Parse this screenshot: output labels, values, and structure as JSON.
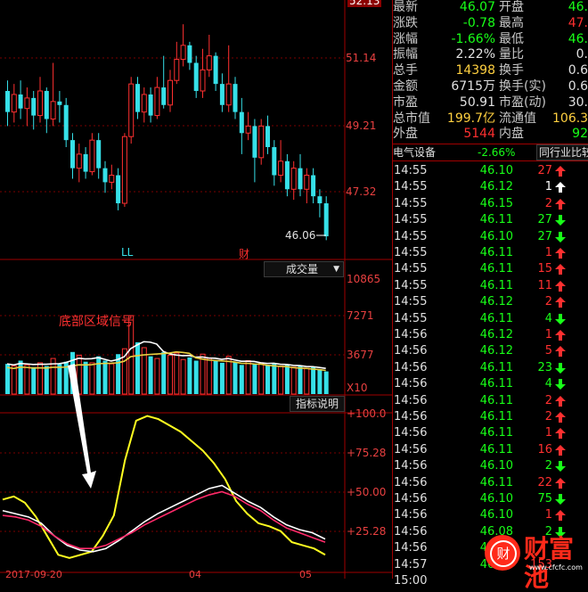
{
  "chart_panel": {
    "price_labels": [
      "52.13",
      "51.14",
      "49.21",
      "47.32"
    ],
    "current_price_marker": "46.06",
    "marker_ll": "LL",
    "marker_cai": "财",
    "volume_selector": "成交量",
    "volume_labels": [
      "10865",
      "7271",
      "3677",
      "X10"
    ],
    "annotation": "底部区域信号",
    "indicator_button": "指标说明",
    "indicator_labels": [
      "+100.0",
      "+75.28",
      "+50.00",
      "+25.28"
    ],
    "date_labels": [
      "2017-09-20",
      "04",
      "05"
    ],
    "colors": {
      "up": "#ff3030",
      "down": "#36e0e8",
      "grid": "#7a0000"
    }
  },
  "quote_panel": {
    "rows": [
      {
        "label": "最新",
        "value": "46.07",
        "label2": "开盘",
        "value2": "46.",
        "color": "#18ff18",
        "color2": "#18ff18"
      },
      {
        "label": "涨跌",
        "value": "-0.78",
        "label2": "最高",
        "value2": "47.",
        "color": "#18ff18",
        "color2": "#ff3030"
      },
      {
        "label": "涨幅",
        "value": "-1.66%",
        "label2": "最低",
        "value2": "46.",
        "color": "#18ff18",
        "color2": "#18ff18"
      },
      {
        "label": "振幅",
        "value": "2.22%",
        "label2": "量比",
        "value2": "0.",
        "color": "#e0e0e0",
        "color2": "#e0e0e0"
      },
      {
        "label": "总手",
        "value": "14398",
        "label2": "换手",
        "value2": "0.6",
        "color": "#ffd040",
        "color2": "#e0e0e0"
      },
      {
        "label": "金额",
        "value": "6715万",
        "label2": "换手(实)",
        "value2": "0.6",
        "color": "#e0e0e0",
        "color2": "#e0e0e0"
      },
      {
        "label": "市盈",
        "value": "50.91",
        "label2": "市盈(动)",
        "value2": "30.",
        "color": "#e0e0e0",
        "color2": "#e0e0e0"
      },
      {
        "label": "总市值",
        "value": "199.7亿",
        "label2": "流通值",
        "value2": "106.3",
        "color": "#ffd040",
        "color2": "#ffd040"
      },
      {
        "label": "外盘",
        "value": "5144",
        "label2": "内盘",
        "value2": "92",
        "color": "#ff3030",
        "color2": "#18ff18"
      }
    ],
    "sector_name": "电气设备",
    "sector_change": "-2.66%",
    "sector_button": "同行业比较"
  },
  "ticks": [
    {
      "time": "14:55",
      "price": "46.10",
      "vol": "27",
      "dir": "up",
      "vcolor": "#ff3030"
    },
    {
      "time": "14:55",
      "price": "46.12",
      "vol": "1",
      "dir": "upw",
      "vcolor": "#ffffff"
    },
    {
      "time": "14:55",
      "price": "46.15",
      "vol": "2",
      "dir": "up",
      "vcolor": "#ff3030"
    },
    {
      "time": "14:55",
      "price": "46.11",
      "vol": "27",
      "dir": "down",
      "vcolor": "#18ff18"
    },
    {
      "time": "14:55",
      "price": "46.10",
      "vol": "27",
      "dir": "down",
      "vcolor": "#18ff18"
    },
    {
      "time": "14:55",
      "price": "46.11",
      "vol": "1",
      "dir": "up",
      "vcolor": "#ff3030"
    },
    {
      "time": "14:55",
      "price": "46.11",
      "vol": "15",
      "dir": "up",
      "vcolor": "#ff3030"
    },
    {
      "time": "14:55",
      "price": "46.11",
      "vol": "11",
      "dir": "up",
      "vcolor": "#ff3030"
    },
    {
      "time": "14:55",
      "price": "46.12",
      "vol": "2",
      "dir": "up",
      "vcolor": "#ff3030"
    },
    {
      "time": "14:55",
      "price": "46.11",
      "vol": "4",
      "dir": "down",
      "vcolor": "#18ff18"
    },
    {
      "time": "14:56",
      "price": "46.12",
      "vol": "1",
      "dir": "up",
      "vcolor": "#ff3030"
    },
    {
      "time": "14:56",
      "price": "46.12",
      "vol": "5",
      "dir": "up",
      "vcolor": "#ff3030"
    },
    {
      "time": "14:56",
      "price": "46.11",
      "vol": "23",
      "dir": "down",
      "vcolor": "#18ff18"
    },
    {
      "time": "14:56",
      "price": "46.11",
      "vol": "4",
      "dir": "down",
      "vcolor": "#18ff18"
    },
    {
      "time": "14:56",
      "price": "46.11",
      "vol": "2",
      "dir": "up",
      "vcolor": "#ff3030"
    },
    {
      "time": "14:56",
      "price": "46.11",
      "vol": "2",
      "dir": "up",
      "vcolor": "#ff3030"
    },
    {
      "time": "14:56",
      "price": "46.11",
      "vol": "1",
      "dir": "up",
      "vcolor": "#ff3030"
    },
    {
      "time": "14:56",
      "price": "46.11",
      "vol": "16",
      "dir": "up",
      "vcolor": "#ff3030"
    },
    {
      "time": "14:56",
      "price": "46.10",
      "vol": "2",
      "dir": "down",
      "vcolor": "#18ff18"
    },
    {
      "time": "14:56",
      "price": "46.11",
      "vol": "22",
      "dir": "up",
      "vcolor": "#ff3030"
    },
    {
      "time": "14:56",
      "price": "46.10",
      "vol": "75",
      "dir": "down",
      "vcolor": "#18ff18"
    },
    {
      "time": "14:56",
      "price": "46.10",
      "vol": "1",
      "dir": "up",
      "vcolor": "#ff3030"
    },
    {
      "time": "14:56",
      "price": "46.08",
      "vol": "2",
      "dir": "down",
      "vcolor": "#18ff18"
    },
    {
      "time": "14:56",
      "price": "46.07",
      "vol": "",
      "dir": "",
      "vcolor": "#18ff18"
    },
    {
      "time": "14:57",
      "price": "46.07",
      "vol": "153",
      "dir": "",
      "vcolor": "#ff3030"
    },
    {
      "time": "15:00",
      "price": "",
      "vol": "",
      "dir": "",
      "vcolor": "#ff3030"
    }
  ],
  "watermark": {
    "text": "财富池",
    "url_text": "www.cfcfc.com"
  },
  "chart_data": {
    "type": "candlestick",
    "candles": [
      [
        50.2,
        49.6,
        50.5,
        49.2
      ],
      [
        49.6,
        50.1,
        50.4,
        49.3
      ],
      [
        50.1,
        49.7,
        50.5,
        49.4
      ],
      [
        49.7,
        50.0,
        50.3,
        49.2
      ],
      [
        50.0,
        49.5,
        50.2,
        49.1
      ],
      [
        49.5,
        50.2,
        50.6,
        49.3
      ],
      [
        50.2,
        49.4,
        50.3,
        49.0
      ],
      [
        49.4,
        49.9,
        51.0,
        49.2
      ],
      [
        49.9,
        49.8,
        50.2,
        49.3
      ],
      [
        49.8,
        48.8,
        50.0,
        48.6
      ],
      [
        48.8,
        48.0,
        49.0,
        47.7
      ],
      [
        48.0,
        48.4,
        48.7,
        47.6
      ],
      [
        48.4,
        47.9,
        48.6,
        47.7
      ],
      [
        47.9,
        48.8,
        49.0,
        47.8
      ],
      [
        48.8,
        48.0,
        49.0,
        47.7
      ],
      [
        48.0,
        47.6,
        48.2,
        47.3
      ],
      [
        47.6,
        47.8,
        48.1,
        47.4
      ],
      [
        47.8,
        47.0,
        48.0,
        46.8
      ],
      [
        47.0,
        48.9,
        49.0,
        46.9
      ],
      [
        48.9,
        50.4,
        50.6,
        48.7
      ],
      [
        50.4,
        49.6,
        50.6,
        49.4
      ],
      [
        49.6,
        50.1,
        50.3,
        49.3
      ],
      [
        50.1,
        49.5,
        50.3,
        49.3
      ],
      [
        49.5,
        50.3,
        50.6,
        49.4
      ],
      [
        50.3,
        49.8,
        51.2,
        49.7
      ],
      [
        49.8,
        50.5,
        50.8,
        49.6
      ],
      [
        50.5,
        51.1,
        51.6,
        50.4
      ],
      [
        51.1,
        51.5,
        52.1,
        50.9
      ],
      [
        51.5,
        51.0,
        51.6,
        50.8
      ],
      [
        51.0,
        50.2,
        51.2,
        50.0
      ],
      [
        50.2,
        50.8,
        51.4,
        50.0
      ],
      [
        50.8,
        51.2,
        51.8,
        50.6
      ],
      [
        51.2,
        50.4,
        51.3,
        50.2
      ],
      [
        50.4,
        49.8,
        50.7,
        49.6
      ],
      [
        49.8,
        50.4,
        51.5,
        49.6
      ],
      [
        50.4,
        49.6,
        50.6,
        49.4
      ],
      [
        49.6,
        49.0,
        50.0,
        48.4
      ],
      [
        49.0,
        49.2,
        49.6,
        48.8
      ],
      [
        49.2,
        48.3,
        49.4,
        47.6
      ],
      [
        48.3,
        49.2,
        49.4,
        48.1
      ],
      [
        49.2,
        48.6,
        49.5,
        48.4
      ],
      [
        48.6,
        47.8,
        48.8,
        47.5
      ],
      [
        47.8,
        48.2,
        48.8,
        47.6
      ],
      [
        48.2,
        47.4,
        48.4,
        47.2
      ],
      [
        47.4,
        48.0,
        48.2,
        47.1
      ],
      [
        48.0,
        47.4,
        48.4,
        47.2
      ],
      [
        47.4,
        47.8,
        48.0,
        47.0
      ],
      [
        47.8,
        47.2,
        48.0,
        47.0
      ],
      [
        47.2,
        47.0,
        47.4,
        46.6
      ],
      [
        47.0,
        46.06,
        47.2,
        45.95
      ]
    ],
    "volume": [
      2800,
      2600,
      3100,
      2700,
      2500,
      2900,
      2600,
      3300,
      2800,
      3000,
      3900,
      3600,
      3000,
      2900,
      3500,
      3100,
      2800,
      3700,
      4200,
      7271,
      4800,
      4300,
      3500,
      3300,
      3900,
      3600,
      3800,
      3200,
      3400,
      3100,
      3700,
      3300,
      3100,
      2900,
      3500,
      3000,
      2700,
      3100,
      2800,
      2900,
      2700,
      2800,
      2600,
      2700,
      2500,
      2600,
      2400,
      2500,
      2300,
      2100
    ],
    "xlabel": "",
    "ylabel": ""
  }
}
